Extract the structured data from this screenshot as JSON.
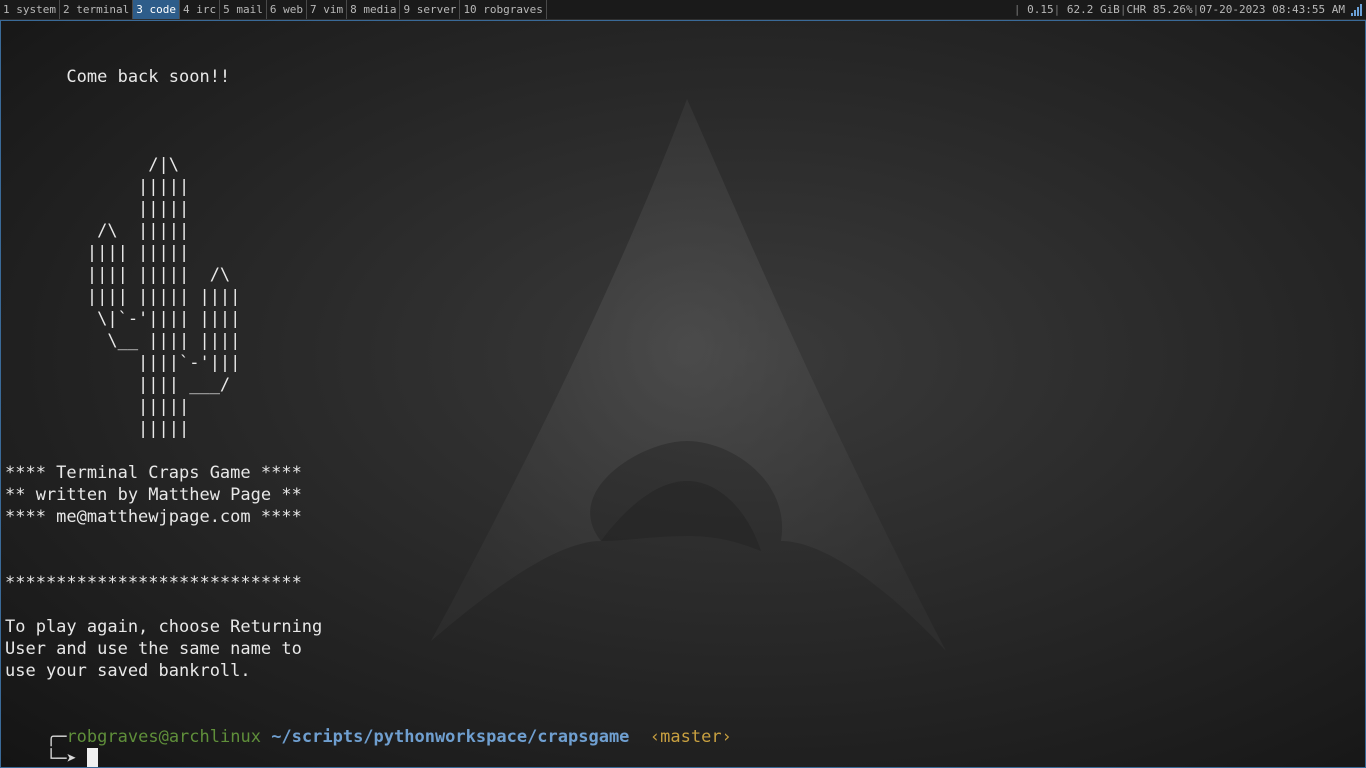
{
  "topbar": {
    "tags": [
      {
        "label": "1 system",
        "active": false
      },
      {
        "label": "2 terminal",
        "active": false
      },
      {
        "label": "3 code",
        "active": true
      },
      {
        "label": "4 irc",
        "active": false
      },
      {
        "label": "5 mail",
        "active": false
      },
      {
        "label": "6 web",
        "active": false
      },
      {
        "label": "7 vim",
        "active": false
      },
      {
        "label": "8 media",
        "active": false
      },
      {
        "label": "9 server",
        "active": false
      },
      {
        "label": "10 robgraves",
        "active": false
      }
    ],
    "status": {
      "load": "0.15",
      "memory": "62.2 GiB",
      "battery": "CHR 85.26%",
      "datetime": "07-20-2023 08:43:55 AM",
      "signal_icon": "signal-bars-icon"
    },
    "accent_color": "#2e5d8a"
  },
  "terminal": {
    "lines": [
      "      Come back soon!!",
      "",
      "",
      "",
      "              /|\\",
      "             |||||",
      "             |||||",
      "         /\\  |||||",
      "        |||| |||||",
      "        |||| |||||  /\\",
      "        |||| ||||| ||||",
      "         \\|`-'|||| ||||",
      "          \\__ |||| ||||",
      "             ||||`-'|||",
      "             |||| ___/",
      "             |||||",
      "             |||||",
      "",
      "**** Terminal Craps Game ****",
      "** written by Matthew Page **",
      "**** me@matthewjpage.com ****",
      "",
      "",
      "*****************************",
      "",
      "To play again, choose Returning",
      "User and use the same name to",
      "use your saved bankroll."
    ],
    "prompt": {
      "user": "robgraves",
      "at": "@",
      "host": "archlinux",
      "path": "~/scripts/pythonworkspace/crapsgame",
      "branch": "‹master›",
      "arrow": "└─➤",
      "top_corner": "╭─"
    }
  }
}
